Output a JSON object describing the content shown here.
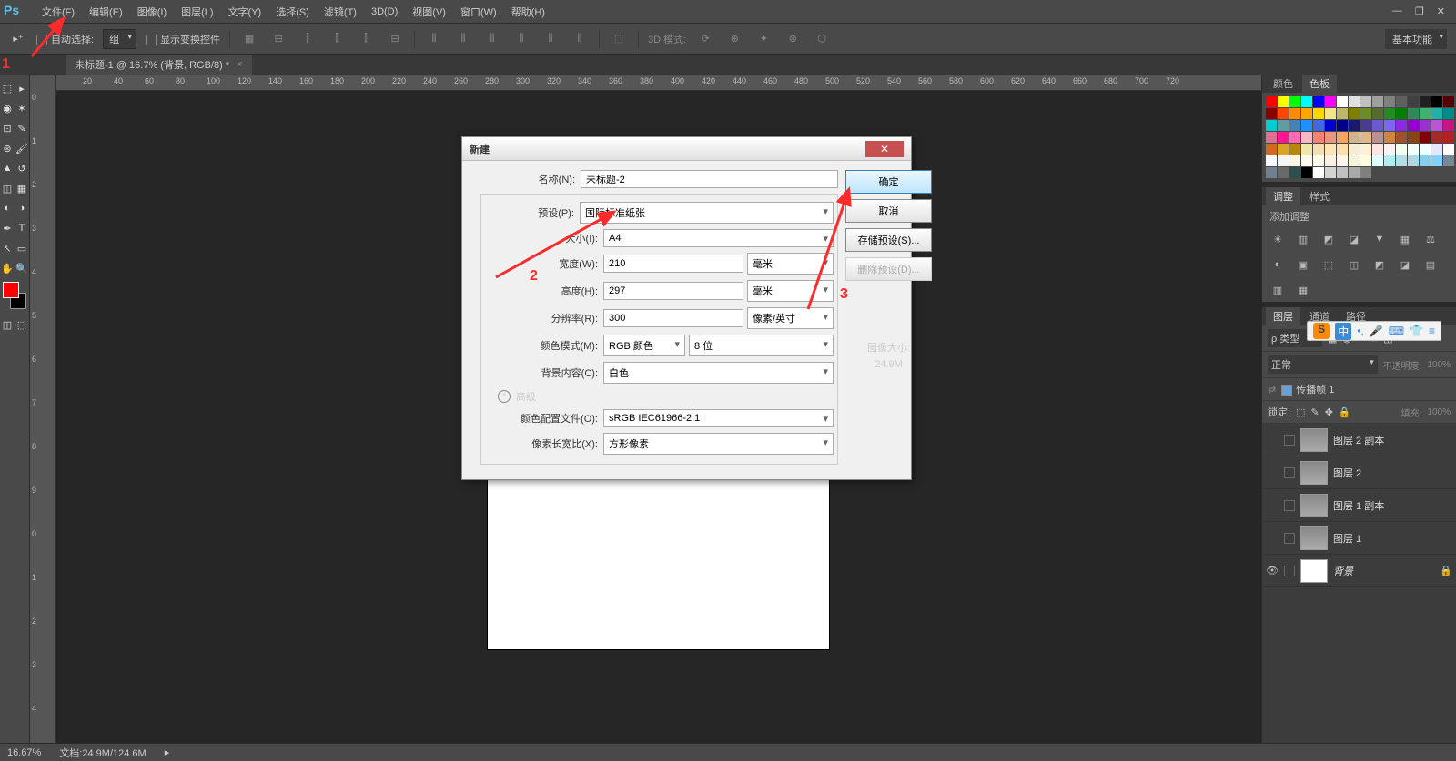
{
  "app": {
    "logo": "Ps"
  },
  "menu": [
    "文件(F)",
    "编辑(E)",
    "图像(I)",
    "图层(L)",
    "文字(Y)",
    "选择(S)",
    "滤镜(T)",
    "3D(D)",
    "视图(V)",
    "窗口(W)",
    "帮助(H)"
  ],
  "optbar": {
    "auto_select": "自动选择:",
    "group": "组",
    "show_transform": "显示变换控件",
    "mode_3d": "3D 模式:",
    "basic": "基本功能"
  },
  "doc_tab": "未标题-1 @ 16.7% (背景, RGB/8) *",
  "ruler_h": [
    "20",
    "40",
    "60",
    "80",
    "100",
    "120",
    "140",
    "160",
    "180",
    "200",
    "220",
    "240",
    "260",
    "280",
    "300",
    "320",
    "340",
    "360",
    "380",
    "400",
    "420",
    "440",
    "460",
    "480",
    "500",
    "520",
    "540",
    "560",
    "580",
    "600",
    "620",
    "640",
    "660",
    "680",
    "700",
    "720"
  ],
  "ruler_v": [
    "1",
    "2",
    "3",
    "4",
    "5",
    "6",
    "7",
    "8",
    "9"
  ],
  "ruler_v_idx": [
    "0",
    "1",
    "2",
    "3",
    "4",
    "5",
    "6",
    "7",
    "8",
    "9",
    "0",
    "1",
    "2",
    "3",
    "4"
  ],
  "panels": {
    "color_tabs": [
      "颜色",
      "色板"
    ],
    "adjust_tabs": [
      "调整",
      "样式"
    ],
    "adjust_label": "添加调整",
    "layer_tabs": [
      "图层",
      "通道",
      "路径"
    ],
    "kind": "ρ 类型",
    "blend": "正常",
    "opacity_lbl": "不透明度:",
    "opacity_val": "100%",
    "lock_lbl": "锁定:",
    "fill_lbl": "填充:",
    "fill_val": "100%",
    "propagate": "传播帧 1",
    "layers": [
      {
        "name": "图层 2 副本"
      },
      {
        "name": "图层 2"
      },
      {
        "name": "图层 1 副本"
      },
      {
        "name": "图层 1"
      },
      {
        "name": "背景",
        "locked": true,
        "bg": true
      }
    ]
  },
  "swatch_colors": [
    "#ff0000",
    "#ffff00",
    "#00ff00",
    "#00ffff",
    "#0000ff",
    "#ff00ff",
    "#ffffff",
    "#e0e0e0",
    "#c0c0c0",
    "#a0a0a0",
    "#808080",
    "#606060",
    "#404040",
    "#202020",
    "#000000",
    "#550000",
    "#8b0000",
    "#ff4500",
    "#ff8c00",
    "#ffa500",
    "#ffd700",
    "#f0e68c",
    "#bdb76b",
    "#808000",
    "#6b8e23",
    "#556b2f",
    "#228b22",
    "#008000",
    "#2e8b57",
    "#3cb371",
    "#20b2aa",
    "#008b8b",
    "#00ced1",
    "#5f9ea0",
    "#4682b4",
    "#1e90ff",
    "#4169e1",
    "#0000cd",
    "#00008b",
    "#191970",
    "#483d8b",
    "#6a5acd",
    "#7b68ee",
    "#8a2be2",
    "#9400d3",
    "#9932cc",
    "#ba55d3",
    "#c71585",
    "#db7093",
    "#ff1493",
    "#ff69b4",
    "#ffb6c1",
    "#fa8072",
    "#e9967a",
    "#f4a460",
    "#d2b48c",
    "#deb887",
    "#bc8f8f",
    "#cd853f",
    "#a0522d",
    "#8b4513",
    "#800000",
    "#a52a2a",
    "#b22222",
    "#d2691e",
    "#daa520",
    "#b8860b",
    "#eee8aa",
    "#f5deb3",
    "#ffe4b5",
    "#ffdead",
    "#faebd7",
    "#ffefd5",
    "#ffe4e1",
    "#fff0f5",
    "#f0fff0",
    "#f5fffa",
    "#f0ffff",
    "#e6e6fa",
    "#fffafa",
    "#f8f8ff",
    "#f5f5f5",
    "#fdf5e6",
    "#fffaf0",
    "#fffff0",
    "#faf0e6",
    "#fff5ee",
    "#f5f5dc",
    "#ffffe0",
    "#e0ffff",
    "#afeeee",
    "#b0e0e6",
    "#add8e6",
    "#87ceeb",
    "#87cefa",
    "#778899",
    "#708090",
    "#696969",
    "#2f4f4f",
    "#000000",
    "#ffffff",
    "#d3d3d3",
    "#c0c0c0",
    "#a9a9a9",
    "#808080"
  ],
  "dialog": {
    "title": "新建",
    "labels": {
      "name": "名称(N):",
      "preset": "预设(P):",
      "size": "大小(I):",
      "width": "宽度(W):",
      "height": "高度(H):",
      "res": "分辨率(R):",
      "color": "颜色模式(M):",
      "bg": "背景内容(C):",
      "advanced": "高级",
      "profile": "颜色配置文件(O):",
      "aspect": "像素长宽比(X):"
    },
    "values": {
      "name": "未标题-2",
      "preset": "国际标准纸张",
      "size": "A4",
      "width": "210",
      "height": "297",
      "res": "300",
      "color": "RGB 颜色",
      "bits": "8 位",
      "bg": "白色",
      "profile": "sRGB IEC61966-2.1",
      "aspect": "方形像素"
    },
    "units": {
      "width": "毫米",
      "height": "毫米",
      "res": "像素/英寸"
    },
    "buttons": {
      "ok": "确定",
      "cancel": "取消",
      "save": "存储预设(S)...",
      "delete": "删除预设(D)..."
    },
    "img_size_lbl": "图像大小:",
    "img_size_val": "24.9M"
  },
  "status": {
    "zoom": "16.67%",
    "doc": "文档:24.9M/124.6M"
  },
  "ime": [
    "中",
    "",
    "",
    "",
    ""
  ],
  "annot": {
    "one": "1",
    "two": "2",
    "three": "3"
  }
}
